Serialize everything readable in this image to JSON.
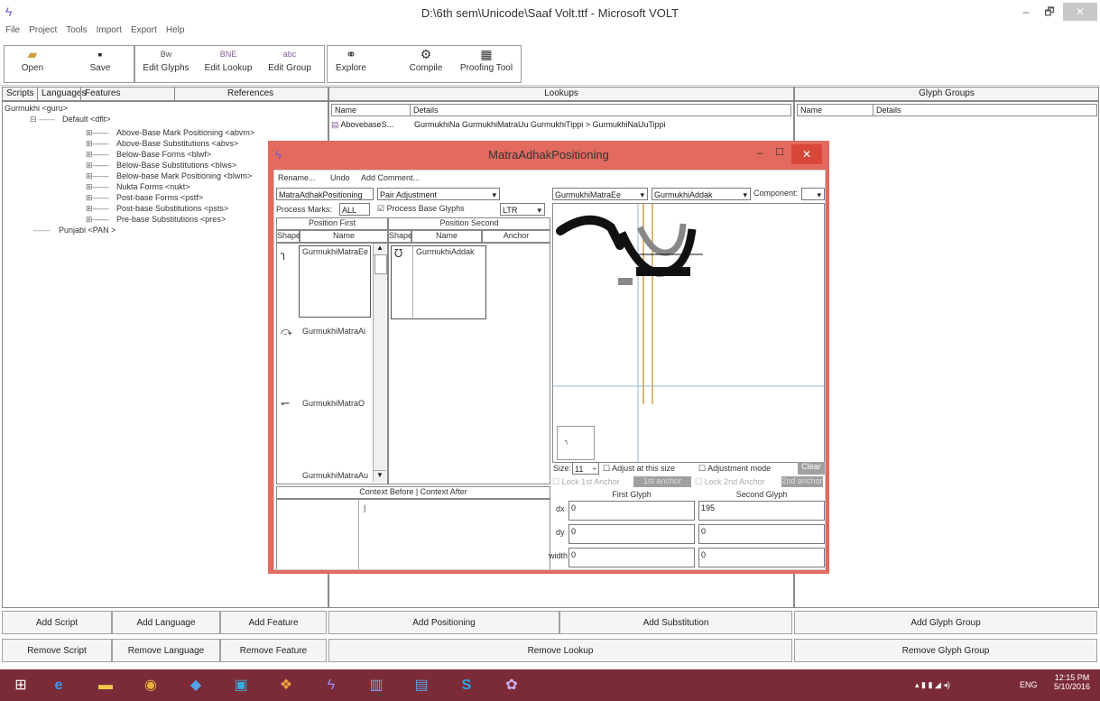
{
  "window": {
    "title": "D:\\6th sem\\Unicode\\Saaf Volt.ttf - Microsoft VOLT",
    "minimize": "–",
    "restore": "🗗",
    "close": "✕"
  },
  "menu": [
    "File",
    "Project",
    "Tools",
    "Import",
    "Export",
    "Help"
  ],
  "toolbar": {
    "open": "Open",
    "save": "Save",
    "edit_glyphs": "Edit Glyphs",
    "edit_lookup": "Edit Lookup",
    "edit_group": "Edit Group",
    "explore": "Explore",
    "compile": "Compile",
    "proofing_tool": "Proofing Tool"
  },
  "left_tabs": {
    "scripts": "Scripts",
    "languages": "Languages",
    "features": "Features",
    "references": "References"
  },
  "tree": {
    "root": "Gurmukhi <guru>",
    "default": "Default <dflt>",
    "features": [
      "Above-Base Mark Positioning <abvm>",
      "Above-Base Substitutions <abvs>",
      "Below-Base Forms <blwf>",
      "Below-Base Substitutions <blws>",
      "Below-base Mark Positioning <blwm>",
      "Nukta Forms <nukt>",
      "Post-base Forms <pstf>",
      "Post-base Substitutions <psts>",
      "Pre-base Substitutions <pres>"
    ],
    "punjabi": "Punjabi <PAN >"
  },
  "lookups": {
    "header": "Lookups",
    "col_name": "Name",
    "col_details": "Details",
    "rows": [
      {
        "name": "AbovebaseS...",
        "details": "GurmukhiNa GurmukhiMatraUu GurmukhiTippi > GurmukhiNaUuTippi"
      }
    ]
  },
  "glyph_groups": {
    "header": "Glyph Groups",
    "col_name": "Name",
    "col_details": "Details"
  },
  "dialog": {
    "title": "MatraAdhakPositioning",
    "menu": [
      "Rename...",
      "Undo",
      "Add Comment..."
    ],
    "lookup_name": "MatraAdhakPositioning",
    "adjustment_type": "Pair Adjustment",
    "process_marks_label": "Process Marks:",
    "process_marks_value": "ALL",
    "process_base_glyphs": "Process Base Glyphs",
    "direction": "LTR",
    "position_first": "Position First",
    "position_second": "Position Second",
    "col_shape": "Shape",
    "col_name": "Name",
    "col_anchor": "Anchor",
    "first_glyphs": [
      "GurmukhiMatraEe",
      "GurmukhiMatraAi",
      "GurmukhiMatraO",
      "GurmukhiMatraAu"
    ],
    "second_glyphs": [
      "GurmukhiAddak"
    ],
    "context_label": "Context Before | Context After",
    "preview_first": "GurmukhiMatraEe",
    "preview_second": "GurmukhiAddak",
    "component_label": "Component:",
    "size_label": "Size:",
    "size_value": "11",
    "adjust_at_size": "Adjust at this size",
    "adjustment_mode": "Adjustment mode",
    "clear": "Clear",
    "lock_1st": "Lock 1st Anchor",
    "lock_2nd": "Lock 2nd Anchor",
    "set_1st": "1st anchor",
    "set_2nd": "2nd anchor",
    "first_glyph": "First Glyph",
    "second_glyph": "Second Glyph",
    "dx_label": "dx",
    "dy_label": "dy",
    "width_label": "width",
    "dx_first": "0",
    "dx_second": "195",
    "dy_first": "0",
    "dy_second": "0",
    "width_first": "0",
    "width_second": "0"
  },
  "bottom_buttons": {
    "add_script": "Add Script",
    "add_language": "Add Language",
    "add_feature": "Add Feature",
    "add_positioning": "Add Positioning",
    "add_substitution": "Add Substitution",
    "add_glyph_group": "Add Glyph Group",
    "remove_script": "Remove Script",
    "remove_language": "Remove Language",
    "remove_feature": "Remove Feature",
    "remove_lookup": "Remove Lookup",
    "remove_glyph_group": "Remove Glyph Group"
  },
  "taskbar": {
    "time": "12:15 PM",
    "date": "5/10/2016",
    "lang": "ENG"
  }
}
